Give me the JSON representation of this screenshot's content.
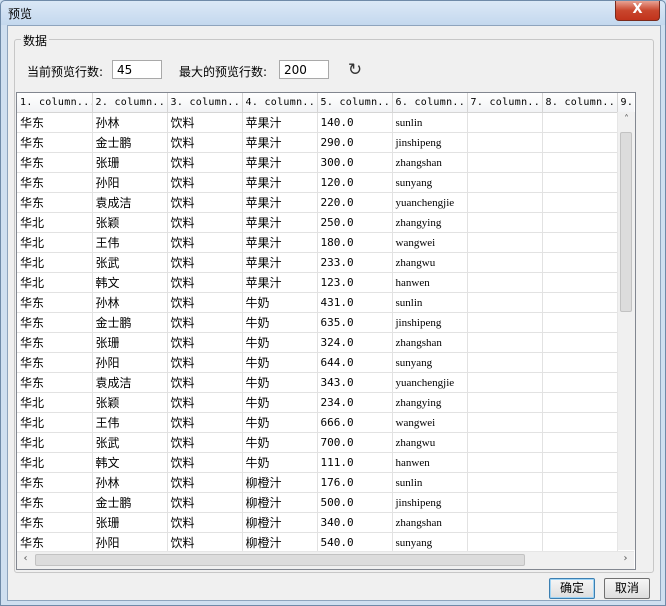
{
  "window": {
    "title": "预览",
    "close_label": "X"
  },
  "group": {
    "legend": "数据"
  },
  "settings": {
    "current_rows_label": "当前预览行数:",
    "current_rows_value": "45",
    "max_rows_label": "最大的预览行数:",
    "max_rows_value": "200",
    "refresh_icon": "refresh-icon"
  },
  "columns": [
    "1. column...",
    "2. column...",
    "3. column...",
    "4. column...",
    "5. column...",
    "6. column...",
    "7. column...",
    "8. column...",
    "9."
  ],
  "rows": [
    [
      "华东",
      "孙林",
      "饮料",
      "苹果汁",
      "140.0",
      "sunlin"
    ],
    [
      "华东",
      "金士鹏",
      "饮料",
      "苹果汁",
      "290.0",
      "jinshipeng"
    ],
    [
      "华东",
      "张珊",
      "饮料",
      "苹果汁",
      "300.0",
      "zhangshan"
    ],
    [
      "华东",
      "孙阳",
      "饮料",
      "苹果汁",
      "120.0",
      "sunyang"
    ],
    [
      "华东",
      "袁成洁",
      "饮料",
      "苹果汁",
      "220.0",
      "yuanchengjie"
    ],
    [
      "华北",
      "张颖",
      "饮料",
      "苹果汁",
      "250.0",
      "zhangying"
    ],
    [
      "华北",
      "王伟",
      "饮料",
      "苹果汁",
      "180.0",
      "wangwei"
    ],
    [
      "华北",
      "张武",
      "饮料",
      "苹果汁",
      "233.0",
      "zhangwu"
    ],
    [
      "华北",
      "韩文",
      "饮料",
      "苹果汁",
      "123.0",
      "hanwen"
    ],
    [
      "华东",
      "孙林",
      "饮料",
      "牛奶",
      "431.0",
      "sunlin"
    ],
    [
      "华东",
      "金士鹏",
      "饮料",
      "牛奶",
      "635.0",
      "jinshipeng"
    ],
    [
      "华东",
      "张珊",
      "饮料",
      "牛奶",
      "324.0",
      "zhangshan"
    ],
    [
      "华东",
      "孙阳",
      "饮料",
      "牛奶",
      "644.0",
      "sunyang"
    ],
    [
      "华东",
      "袁成洁",
      "饮料",
      "牛奶",
      "343.0",
      "yuanchengjie"
    ],
    [
      "华北",
      "张颖",
      "饮料",
      "牛奶",
      "234.0",
      "zhangying"
    ],
    [
      "华北",
      "王伟",
      "饮料",
      "牛奶",
      "666.0",
      "wangwei"
    ],
    [
      "华北",
      "张武",
      "饮料",
      "牛奶",
      "700.0",
      "zhangwu"
    ],
    [
      "华北",
      "韩文",
      "饮料",
      "牛奶",
      "111.0",
      "hanwen"
    ],
    [
      "华东",
      "孙林",
      "饮料",
      "柳橙汁",
      "176.0",
      "sunlin"
    ],
    [
      "华东",
      "金士鹏",
      "饮料",
      "柳橙汁",
      "500.0",
      "jinshipeng"
    ],
    [
      "华东",
      "张珊",
      "饮料",
      "柳橙汁",
      "340.0",
      "zhangshan"
    ],
    [
      "华东",
      "孙阳",
      "饮料",
      "柳橙汁",
      "540.0",
      "sunyang"
    ]
  ],
  "buttons": {
    "ok": "确定",
    "cancel": "取消"
  }
}
